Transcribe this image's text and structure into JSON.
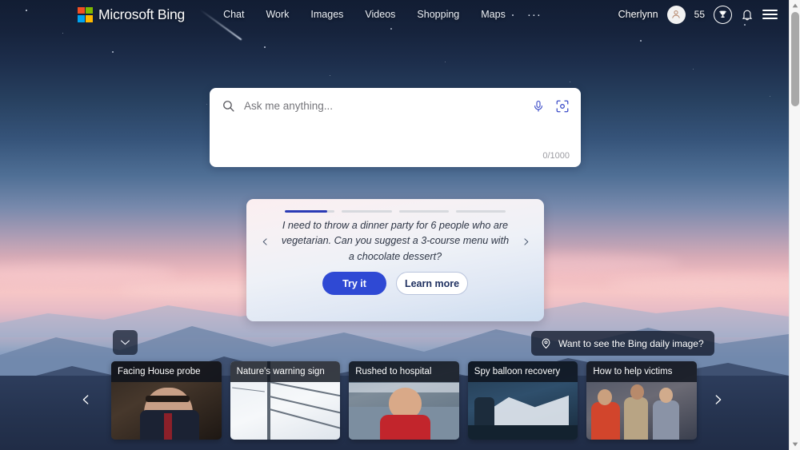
{
  "brand": {
    "name": "Microsoft Bing",
    "logo_icon": "microsoft-squares-logo"
  },
  "nav": {
    "items": [
      {
        "label": "Chat"
      },
      {
        "label": "Work"
      },
      {
        "label": "Images"
      },
      {
        "label": "Videos"
      },
      {
        "label": "Shopping"
      },
      {
        "label": "Maps"
      }
    ],
    "more_label": "···"
  },
  "account": {
    "user_name": "Cherlynn",
    "avatar_icon": "person-avatar-icon",
    "rewards_points": "55",
    "rewards_icon": "trophy-icon",
    "notifications_icon": "bell-icon",
    "menu_icon": "hamburger-menu-icon"
  },
  "search": {
    "placeholder": "Ask me anything...",
    "value": "",
    "search_icon": "magnifier-icon",
    "mic_icon": "microphone-icon",
    "visual_search_icon": "visual-search-camera-icon",
    "char_counter": "0/1000"
  },
  "suggestion_card": {
    "progress": [
      85,
      0,
      0,
      0
    ],
    "prompt": "I need to throw a dinner party for 6 people who are vegetarian. Can you suggest a 3-course menu with a chocolate dessert?",
    "prev_icon": "chevron-left-icon",
    "next_icon": "chevron-right-icon",
    "primary_label": "Try it",
    "secondary_label": "Learn more",
    "accent_color": "#2f49d4"
  },
  "daily_image": {
    "label": "Want to see the Bing daily image?",
    "icon": "info-pin-icon"
  },
  "collapse_toggle": {
    "icon": "chevron-down-icon"
  },
  "carousel": {
    "prev_icon": "chevron-left-icon",
    "next_icon": "chevron-right-icon",
    "cards": [
      {
        "title": "Facing House probe"
      },
      {
        "title": "Nature's warning sign"
      },
      {
        "title": "Rushed to hospital"
      },
      {
        "title": "Spy balloon recovery"
      },
      {
        "title": "How to help victims"
      }
    ]
  },
  "scrollbar": {
    "up_icon": "scroll-up-arrow-icon",
    "down_icon": "scroll-down-arrow-icon"
  }
}
